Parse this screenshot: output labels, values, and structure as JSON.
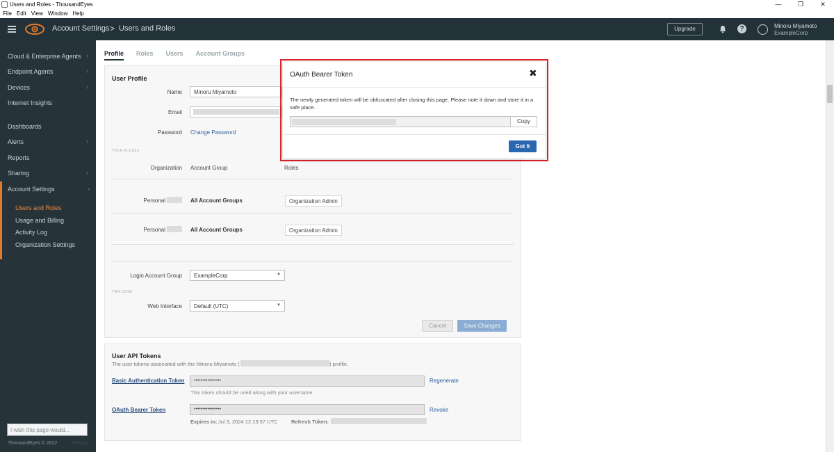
{
  "window": {
    "title": "Users and Roles - ThousandEyes",
    "controls": [
      "—",
      "❐",
      "✕"
    ]
  },
  "menu": [
    "File",
    "Edit",
    "View",
    "Window",
    "Help"
  ],
  "header": {
    "crumb1": "Account Settings",
    "crumb_sep": ">",
    "crumb2": "Users and Roles",
    "upgrade_label": "Upgrade",
    "user_name": "Minoru Miyamoto",
    "user_org": "ExampleCorp",
    "help_glyph": "?"
  },
  "sidebar": {
    "items": [
      {
        "label": "Cloud & Enterprise Agents",
        "chevron": true
      },
      {
        "label": "Endpoint Agents",
        "chevron": true
      },
      {
        "label": "Devices",
        "chevron": true
      },
      {
        "label": "Internet Insights",
        "chevron": false
      },
      {
        "label": "Dashboards",
        "chevron": false
      },
      {
        "label": "Alerts",
        "chevron": true
      },
      {
        "label": "Reports",
        "chevron": false
      },
      {
        "label": "Sharing",
        "chevron": true
      },
      {
        "label": "Account Settings",
        "chevron": true
      }
    ],
    "sub_items": [
      "Users and Roles",
      "Usage and Billing",
      "Activity Log",
      "Organization Settings"
    ],
    "feedback_placeholder": "I wish this page would...",
    "copyright": "ThousandEyes © 2022",
    "privacy": "Privacy",
    "accent": "#e07a2e"
  },
  "tabs": [
    "Profile",
    "Roles",
    "Users",
    "Account Groups"
  ],
  "profile": {
    "section_title": "User Profile",
    "name_label": "Name",
    "name_value": "Minoru Miyamoto",
    "email_label": "Email",
    "password_label": "Password",
    "change_password": "Change Password",
    "access_caption": "YOUR ACCESS",
    "org_header": "Organization",
    "group_header": "Account Group",
    "roles_header": "Roles",
    "access_rows": [
      {
        "org": "Personal",
        "group": "All Account Groups",
        "role": "Organization Admin"
      },
      {
        "org": "Personal",
        "group": "All Account Groups",
        "role": "Organization Admin"
      }
    ],
    "login_group_label": "Login Account Group",
    "login_group_value": "ExampleCorp",
    "timezone_caption": "TIME ZONE",
    "web_interface_label": "Web Interface",
    "web_interface_value": "Default (UTC)",
    "cancel_label": "Cancel",
    "save_label": "Save Changes"
  },
  "tokens": {
    "section_title": "User API Tokens",
    "subtitle_prefix": "The user tokens associated with the Minoru Miyamoto (",
    "subtitle_suffix": ") profile.",
    "basic_label": "Basic Authentication Token",
    "basic_value": "••••••••••••••••",
    "basic_action": "Regenerate",
    "basic_hint": "This token should be used along with your username",
    "oauth_label": "OAuth Bearer Token",
    "oauth_value": "••••••••••••••••",
    "oauth_action": "Revoke",
    "expires_label": "Expires in:",
    "expires_value": "Jul 3, 2024 12:13:57 UTC",
    "refresh_label": "Refresh Token:"
  },
  "modal": {
    "title": "OAuth Bearer Token",
    "close_glyph": "✖",
    "body": "The newly generated token will be obfuscated after closing this page. Please note it down and store it in a safe place.",
    "copy_label": "Copy",
    "gotit_label": "Got It",
    "highlight_color": "#d9232a"
  }
}
